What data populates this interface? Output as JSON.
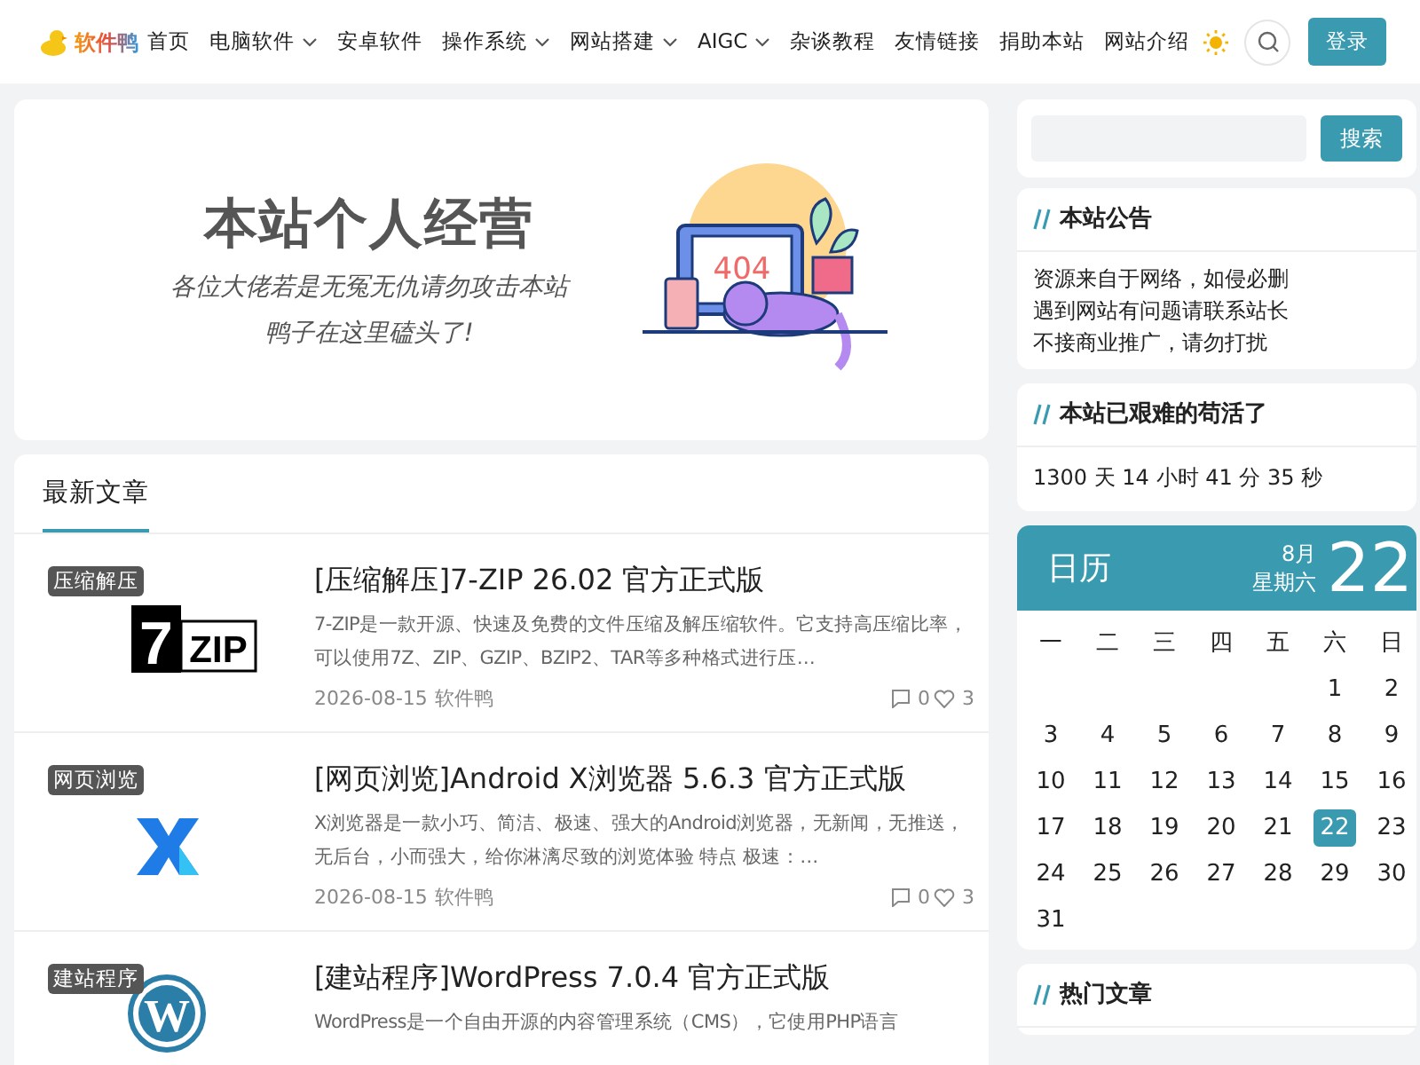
{
  "header": {
    "logo": "软件鸭",
    "nav": [
      {
        "label": "首页",
        "dropdown": false
      },
      {
        "label": "电脑软件",
        "dropdown": true
      },
      {
        "label": "安卓软件",
        "dropdown": false
      },
      {
        "label": "操作系统",
        "dropdown": true
      },
      {
        "label": "网站搭建",
        "dropdown": true
      },
      {
        "label": "AIGC",
        "dropdown": true
      },
      {
        "label": "杂谈教程",
        "dropdown": false
      },
      {
        "label": "友情链接",
        "dropdown": false
      },
      {
        "label": "捐助本站",
        "dropdown": false
      },
      {
        "label": "网站介绍",
        "dropdown": false
      }
    ],
    "login_button": "登录"
  },
  "banner": {
    "title": "本站个人经营",
    "lines": [
      "各位大佬若是无冤无仇请勿攻击本站",
      "鸭子在这里磕头了!"
    ],
    "illustration_text": "404"
  },
  "latest": {
    "heading": "最新文章",
    "articles": [
      {
        "category": "压缩解压",
        "kind": "zip",
        "logo_text": [
          "7",
          "ZIP"
        ],
        "title": "[压缩解压]7-ZIP 26.02 官方正式版",
        "excerpt": "7-ZIP是一款开源、快速及免费的文件压缩及解压缩软件。它支持高压缩比率，可以使用7Z、ZIP、GZIP、BZIP2、TAR等多种格式进行压…",
        "date": "2026-08-15",
        "author": "软件鸭",
        "comments": "0",
        "likes": "3"
      },
      {
        "category": "网页浏览",
        "kind": "cross",
        "title": "[网页浏览]Android X浏览器 5.6.3 官方正式版",
        "excerpt": "X浏览器是一款小巧、简洁、极速、强大的Android浏览器，无新闻，无推送，无后台，小而强大，给你淋漓尽致的浏览体验 特点 极速：…",
        "date": "2026-08-15",
        "author": "软件鸭",
        "comments": "0",
        "likes": "3"
      },
      {
        "category": "建站程序",
        "kind": "wp",
        "logo_text": [
          "W"
        ],
        "title": "[建站程序]WordPress 7.0.4 官方正式版",
        "excerpt": "WordPress是一个自由开源的内容管理系统（CMS），它使用PHP语言"
      }
    ]
  },
  "sidebar": {
    "search_button": "搜索",
    "notice": {
      "heading": "本站公告",
      "lines": [
        "资源来自于网络，如侵必删",
        "遇到网站有问题请联系站长",
        "不接商业推广，请勿打扰"
      ]
    },
    "uptime": {
      "heading": "本站已艰难的苟活了",
      "text": "1300 天 14 小时 41 分 35 秒"
    },
    "calendar": {
      "title": "日历",
      "month": "8月",
      "weekday": "星期六",
      "day": "22",
      "weekdays": [
        "一",
        "二",
        "三",
        "四",
        "五",
        "六",
        "日"
      ],
      "weeks": [
        {
          "kind": "first",
          "days": [
            {
              "label": "1",
              "selected": false
            },
            {
              "label": "2",
              "selected": false
            }
          ]
        },
        {
          "kind": "week",
          "days": [
            {
              "label": "3",
              "selected": false
            },
            {
              "label": "4",
              "selected": false
            },
            {
              "label": "5",
              "selected": false
            },
            {
              "label": "6",
              "selected": false
            },
            {
              "label": "7",
              "selected": false
            },
            {
              "label": "8",
              "selected": false
            },
            {
              "label": "9",
              "selected": false
            }
          ]
        },
        {
          "kind": "week",
          "days": [
            {
              "label": "10",
              "selected": false
            },
            {
              "label": "11",
              "selected": false
            },
            {
              "label": "12",
              "selected": false
            },
            {
              "label": "13",
              "selected": false
            },
            {
              "label": "14",
              "selected": false
            },
            {
              "label": "15",
              "selected": false
            },
            {
              "label": "16",
              "selected": false
            }
          ]
        },
        {
          "kind": "week",
          "days": [
            {
              "label": "17",
              "selected": false
            },
            {
              "label": "18",
              "selected": false
            },
            {
              "label": "19",
              "selected": false
            },
            {
              "label": "20",
              "selected": false
            },
            {
              "label": "21",
              "selected": false
            },
            {
              "label": "22",
              "selected": true
            },
            {
              "label": "23",
              "selected": false
            }
          ]
        },
        {
          "kind": "week",
          "days": [
            {
              "label": "24",
              "selected": false
            },
            {
              "label": "25",
              "selected": false
            },
            {
              "label": "26",
              "selected": false
            },
            {
              "label": "27",
              "selected": false
            },
            {
              "label": "28",
              "selected": false
            },
            {
              "label": "29",
              "selected": false
            },
            {
              "label": "30",
              "selected": false
            }
          ]
        },
        {
          "kind": "week",
          "days": [
            {
              "label": "31",
              "selected": false
            }
          ]
        }
      ]
    },
    "hot": {
      "heading": "热门文章"
    }
  }
}
